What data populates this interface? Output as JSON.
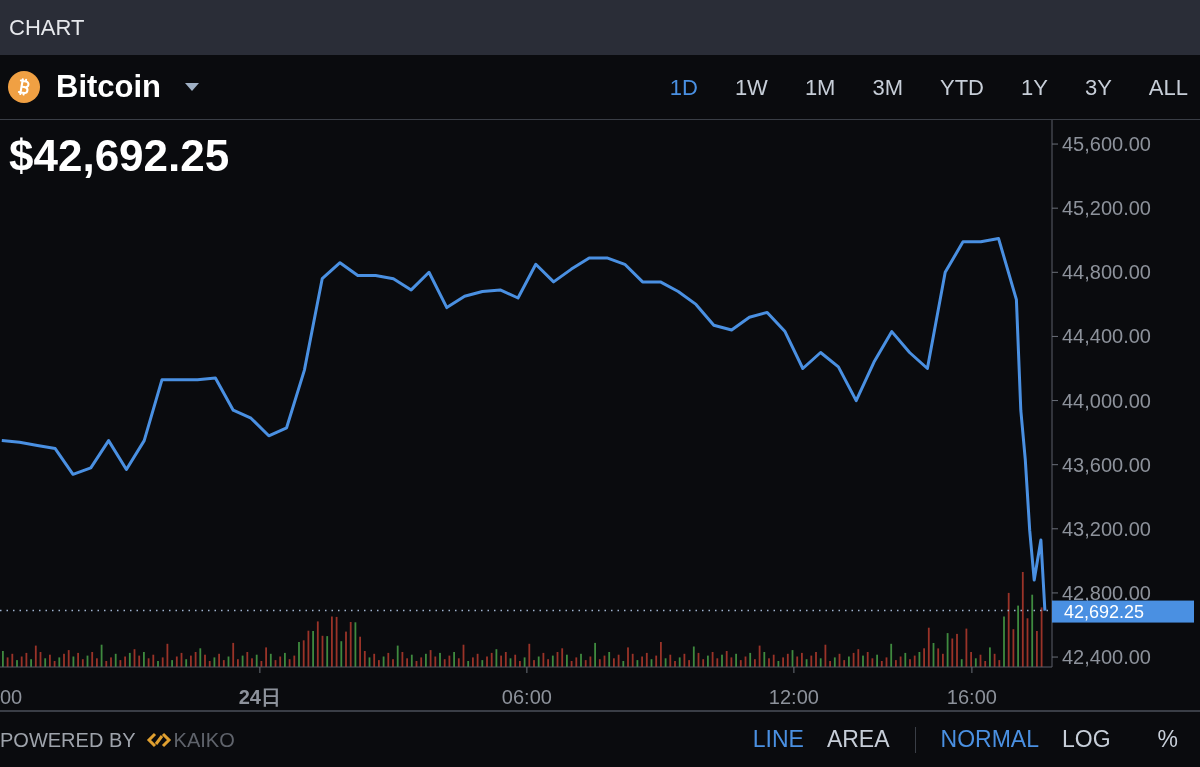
{
  "header": {
    "title": "CHART"
  },
  "ranges": [
    {
      "label": "1D",
      "selected": true
    },
    {
      "label": "1W",
      "selected": false
    },
    {
      "label": "1M",
      "selected": false
    },
    {
      "label": "3M",
      "selected": false
    },
    {
      "label": "YTD",
      "selected": false
    },
    {
      "label": "1Y",
      "selected": false
    },
    {
      "label": "3Y",
      "selected": false
    },
    {
      "label": "ALL",
      "selected": false
    }
  ],
  "price": "$42,692.25",
  "chart": {
    "chart_data": {
      "type": "line",
      "x": [
        -5.8,
        -5.4,
        -5.0,
        -4.6,
        -4.2,
        -3.8,
        -3.4,
        -3.0,
        -2.6,
        -2.2,
        -1.8,
        -1.4,
        -1.0,
        -0.6,
        -0.2,
        0.2,
        0.6,
        1.0,
        1.4,
        1.8,
        2.2,
        2.6,
        3.0,
        3.4,
        3.8,
        4.2,
        4.6,
        5.0,
        5.4,
        5.8,
        6.2,
        6.6,
        7.0,
        7.4,
        7.8,
        8.2,
        8.6,
        9.0,
        9.4,
        9.8,
        10.2,
        10.6,
        11.0,
        11.4,
        11.8,
        12.2,
        12.6,
        13.0,
        13.4,
        13.8,
        14.2,
        14.6,
        15.0,
        15.4,
        15.8,
        16.2,
        16.6,
        17.0,
        17.1,
        17.2,
        17.3,
        17.4,
        17.55,
        17.64
      ],
      "series": [
        {
          "name": "Bitcoin",
          "color": "#4a90e2",
          "values": [
            43750,
            43740,
            43720,
            43700,
            43540,
            43580,
            43750,
            43570,
            43750,
            44130,
            44130,
            44130,
            44140,
            43940,
            43890,
            43780,
            43830,
            44190,
            44760,
            44860,
            44780,
            44780,
            44760,
            44690,
            44800,
            44580,
            44650,
            44680,
            44690,
            44640,
            44850,
            44740,
            44820,
            44890,
            44890,
            44850,
            44740,
            44740,
            44680,
            44600,
            44470,
            44440,
            44520,
            44550,
            44430,
            44200,
            44300,
            44210,
            44000,
            44240,
            44430,
            44300,
            44200,
            44800,
            44990,
            44990,
            45010,
            44630,
            43940,
            43630,
            43190,
            42880,
            43130,
            42690
          ]
        }
      ],
      "xlim": [
        -5.84,
        17.8
      ],
      "ylim": [
        42338,
        45750
      ],
      "xticks": [
        {
          "value": 6,
          "label": "06:00"
        },
        {
          "value": 12,
          "label": "12:00"
        },
        {
          "value": 16,
          "label": "16:00"
        }
      ],
      "yticks": [
        {
          "value": 45600,
          "label": "45,600.00"
        },
        {
          "value": 45200,
          "label": "45,200.00"
        },
        {
          "value": 44800,
          "label": "44,800.00"
        },
        {
          "value": 44400,
          "label": "44,400.00"
        },
        {
          "value": 44000,
          "label": "44,000.00"
        },
        {
          "value": 43600,
          "label": "43,600.00"
        },
        {
          "value": 43200,
          "label": "43,200.00"
        },
        {
          "value": 42800,
          "label": "42,800.00"
        },
        {
          "value": 42400,
          "label": "42,400.00"
        }
      ],
      "annotations": [
        "42,692.25"
      ]
    },
    "cut_x_label": "00",
    "date_label": "24日"
  },
  "footer": {
    "powered_by": "POWERED BY",
    "provider": "KAIKO",
    "chart_types": [
      {
        "label": "LINE",
        "selected": true
      },
      {
        "label": "AREA",
        "selected": false
      }
    ],
    "scales": [
      {
        "label": "NORMAL",
        "selected": true
      },
      {
        "label": "LOG",
        "selected": false
      },
      {
        "label": "%",
        "selected": false
      }
    ]
  }
}
